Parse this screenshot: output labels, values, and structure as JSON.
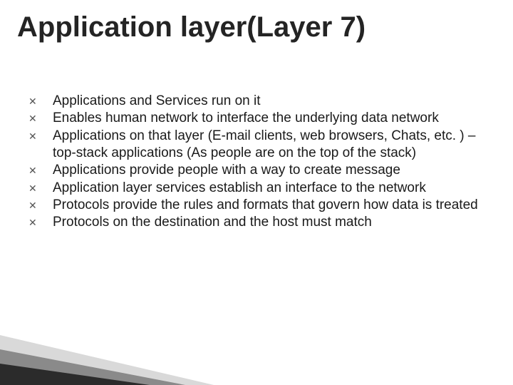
{
  "title": "Application layer(Layer 7)",
  "bullets": [
    "Applications and Services run on it",
    "Enables human network to interface the underlying data network",
    "Applications on that layer (E-mail clients, web browsers, Chats, etc. ) – top-stack applications (As people are on the top of the stack)",
    "Applications provide people with a way to create message",
    "Application layer services establish an interface to the network",
    "Protocols provide the rules and formats that govern how data is treated",
    "Protocols on the destination and the host must match"
  ],
  "bullet_glyph": "✕"
}
